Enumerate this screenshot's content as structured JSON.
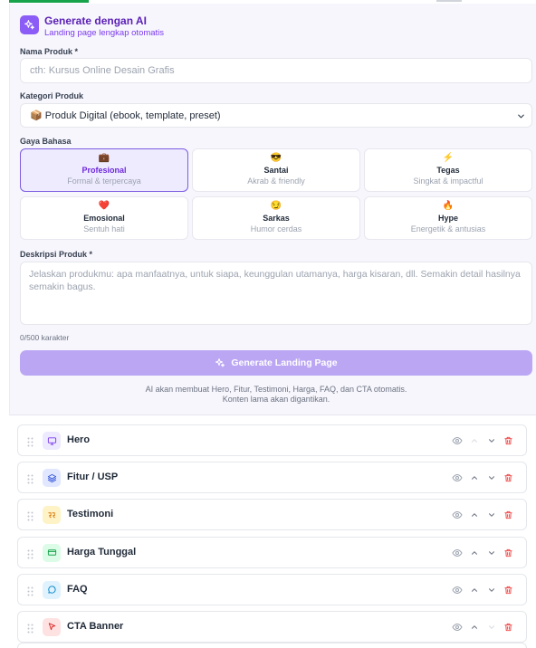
{
  "ai_panel": {
    "title": "Generate dengan AI",
    "subtitle": "Landing page lengkap otomatis",
    "accent": "#8b5cf6"
  },
  "form": {
    "product_name_label": "Nama Produk *",
    "product_name_value": "",
    "product_name_placeholder": "cth: Kursus Online Desain Grafis",
    "category_label": "Kategori Produk",
    "category_selected": "📦 Produk Digital (ebook, template, preset)",
    "style_label": "Gaya Bahasa",
    "tones": [
      {
        "emoji": "💼",
        "name": "Profesional",
        "desc": "Formal & terpercaya",
        "selected": true
      },
      {
        "emoji": "😎",
        "name": "Santai",
        "desc": "Akrab & friendly",
        "selected": false
      },
      {
        "emoji": "⚡",
        "name": "Tegas",
        "desc": "Singkat & impactful",
        "selected": false
      },
      {
        "emoji": "❤️",
        "name": "Emosional",
        "desc": "Sentuh hati",
        "selected": false
      },
      {
        "emoji": "😏",
        "name": "Sarkas",
        "desc": "Humor cerdas",
        "selected": false
      },
      {
        "emoji": "🔥",
        "name": "Hype",
        "desc": "Energetik & antusias",
        "selected": false
      }
    ],
    "description_label": "Deskripsi Produk *",
    "description_value": "",
    "description_placeholder": "Jelaskan produkmu: apa manfaatnya, untuk siapa, keunggulan utamanya, harga kisaran, dll. Semakin detail hasilnya semakin bagus.",
    "char_counter": "0/500 karakter",
    "generate_button": "Generate Landing Page",
    "note_line1": "AI akan membuat Hero, Fitur, Testimoni, Harga, FAQ, dan CTA otomatis.",
    "note_line2": "Konten lama akan digantikan."
  },
  "sections": [
    {
      "name": "Hero",
      "icon": "monitor-icon",
      "icon_bg": "#ede9fe",
      "icon_color": "#7c3aed"
    },
    {
      "name": "Fitur / USP",
      "icon": "layers-icon",
      "icon_bg": "#e0e7ff",
      "icon_color": "#3b5bdb"
    },
    {
      "name": "Testimoni",
      "icon": "quote-icon",
      "icon_bg": "#fef3c7",
      "icon_color": "#d97706"
    },
    {
      "name": "Harga Tunggal",
      "icon": "credit-card-icon",
      "icon_bg": "#dcfce7",
      "icon_color": "#16a34a"
    },
    {
      "name": "FAQ",
      "icon": "chat-bubble-icon",
      "icon_bg": "#e0f2fe",
      "icon_color": "#0284c7"
    },
    {
      "name": "CTA Banner",
      "icon": "cursor-icon",
      "icon_bg": "#fee2e2",
      "icon_color": "#dc2626"
    }
  ],
  "colors": {
    "danger": "#ef4444",
    "muted": "#9ca3af",
    "button": "#bba6f4"
  }
}
